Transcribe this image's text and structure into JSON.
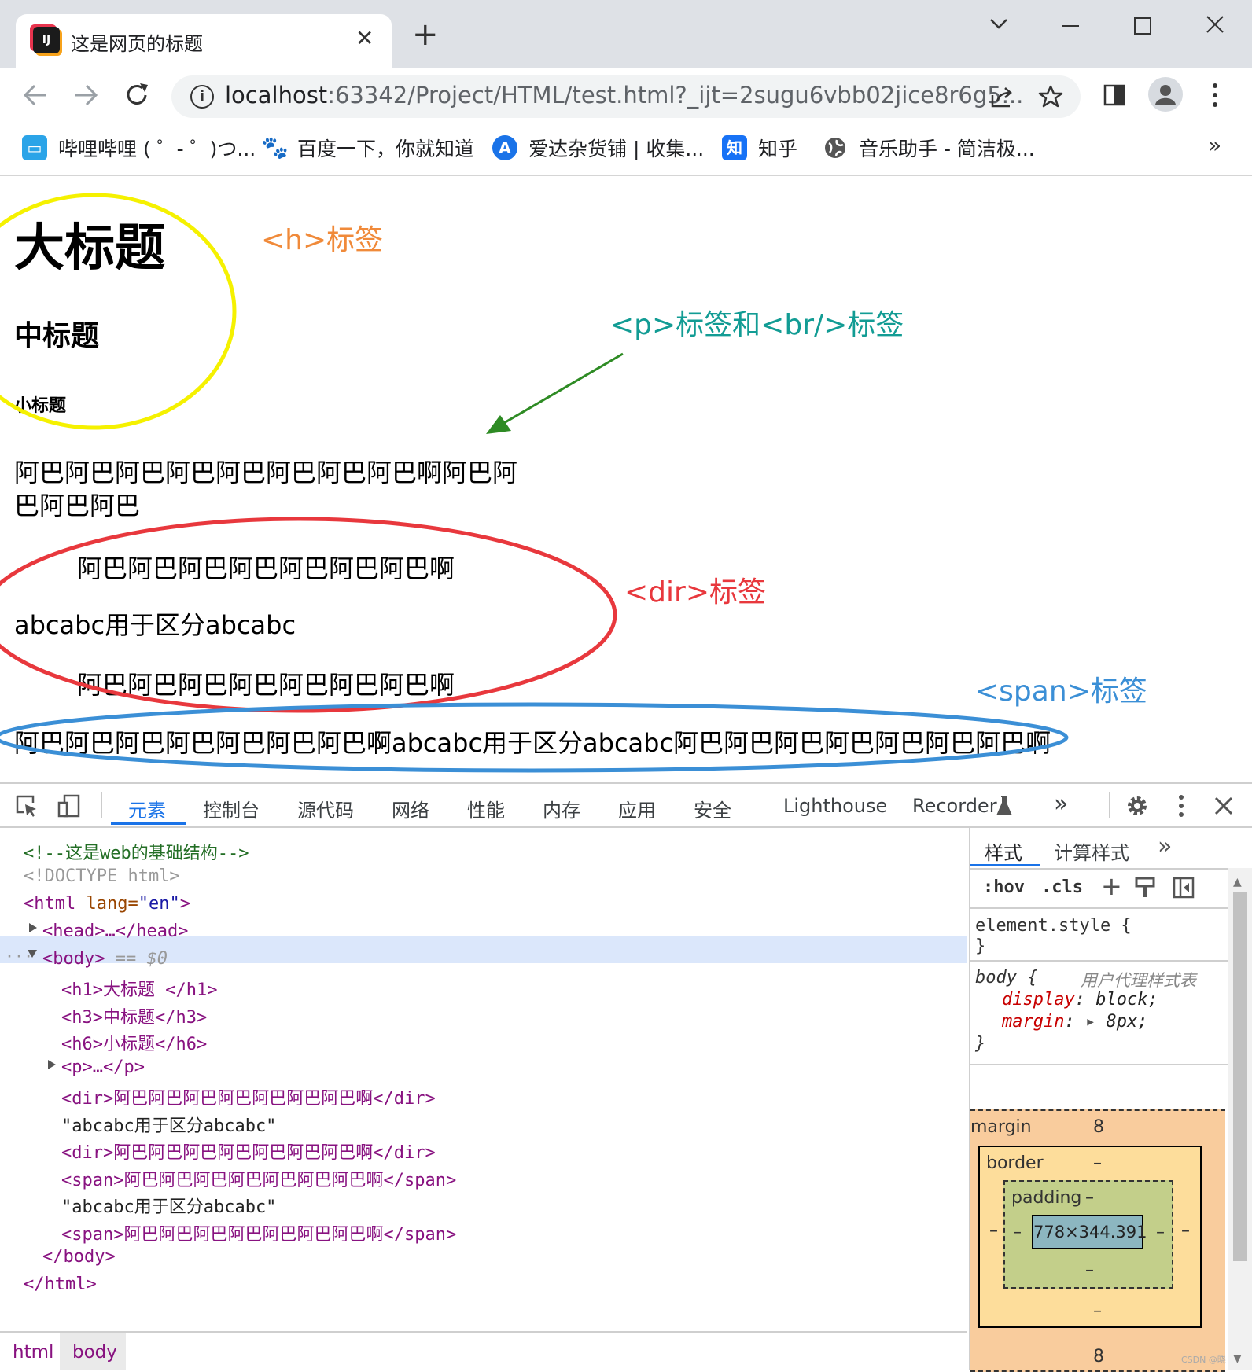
{
  "browser": {
    "tab_title": "这是网页的标题",
    "tab_favicon_text": "IJ",
    "close_glyph": "✕",
    "new_tab_glyph": "+",
    "url_host": "localhost",
    "url_rest": ":63342/Project/HTML/test.html?_ijt=2sugu6vbb02jice8r6g5...",
    "bookmarks": [
      {
        "label": "哔哩哔哩 ( ゜- ゜)つ...",
        "icon": "bilibili-icon"
      },
      {
        "label": "百度一下，你就知道",
        "icon": "baidu-icon"
      },
      {
        "label": "爱达杂货铺 | 收集...",
        "icon": "letter-a-icon"
      },
      {
        "label": "知乎",
        "icon": "zhihu-icon"
      },
      {
        "label": "音乐助手 - 简洁极...",
        "icon": "globe-icon"
      }
    ],
    "bookmarks_overflow": "»"
  },
  "page": {
    "h1": "大标题",
    "h3": "中标题",
    "h6": "小标题",
    "p_line1": "阿巴阿巴阿巴阿巴阿巴阿巴阿巴阿巴啊阿巴阿",
    "p_line2": "巴阿巴阿巴",
    "dir1": "阿巴阿巴阿巴阿巴阿巴阿巴阿巴啊",
    "text_between": "abcabc用于区分abcabc",
    "dir2": "阿巴阿巴阿巴阿巴阿巴阿巴阿巴啊",
    "span_line": "阿巴阿巴阿巴阿巴阿巴阿巴阿巴啊abcabc用于区分abcabc阿巴阿巴阿巴阿巴阿巴阿巴阿巴啊"
  },
  "annotations": {
    "h_label": "<h>标签",
    "p_label": "<p>标签和<br/>标签",
    "dir_label": "<dir>标签",
    "span_label": "<span>标签"
  },
  "colors": {
    "h_label": "#f08a3a",
    "p_label": "#129c94",
    "dir_label": "#e8383d",
    "span_label": "#3b8fd6",
    "yellow_ellipse": "#f5f100",
    "red_ellipse": "#e8383d",
    "blue_ellipse": "#3b8fd6",
    "arrow": "#2e8b24"
  },
  "devtools": {
    "tabs": [
      "元素",
      "控制台",
      "源代码",
      "网络",
      "性能",
      "内存",
      "应用",
      "安全",
      "Lighthouse",
      "Recorder"
    ],
    "active_tab": "元素",
    "more_tabs": "»",
    "dom_lines": {
      "comment": "<!--这是web的基础结构-->",
      "doctype": "<!DOCTYPE html>",
      "html_open_tag": "<html",
      "html_attr": " lang=",
      "html_attr_val": "\"en\"",
      "html_open_end": ">",
      "head": "<head>…</head>",
      "body_open": "<body>",
      "body_sel": " == $0",
      "h1": "<h1>大标题 </h1>",
      "h3": "<h3>中标题</h3>",
      "h6": "<h6>小标题</h6>",
      "p": "<p>…</p>",
      "dir1": "<dir>阿巴阿巴阿巴阿巴阿巴阿巴阿巴啊</dir>",
      "text1": "\"abcabc用于区分abcabc\"",
      "dir2": "<dir>阿巴阿巴阿巴阿巴阿巴阿巴阿巴啊</dir>",
      "span1": "<span>阿巴阿巴阿巴阿巴阿巴阿巴阿巴啊</span>",
      "text2": "\"abcabc用于区分abcabc\"",
      "span2": "<span>阿巴阿巴阿巴阿巴阿巴阿巴阿巴啊</span>",
      "body_close": "</body>",
      "html_close": "</html>"
    },
    "styles_tabs": [
      "样式",
      "计算样式"
    ],
    "styles_more": "»",
    "filter_hov": ":hov",
    "filter_cls": ".cls",
    "element_style": "element.style {",
    "close_brace": "}",
    "body_rule": "body {",
    "ua_label": "用户代理样式表",
    "prop1_name": "display",
    "prop1_val": "block;",
    "prop2_name": "margin",
    "prop2_val": "8px;",
    "box_model": {
      "margin_label": "margin",
      "margin_top": "8",
      "margin_bottom": "8",
      "border_label": "border",
      "border_val": "–",
      "padding_label": "padding",
      "padding_val": "–",
      "content": "778×344.391",
      "side": "–"
    },
    "breadcrumbs": [
      "html",
      "body"
    ],
    "watermark": "CSDN @晓"
  }
}
